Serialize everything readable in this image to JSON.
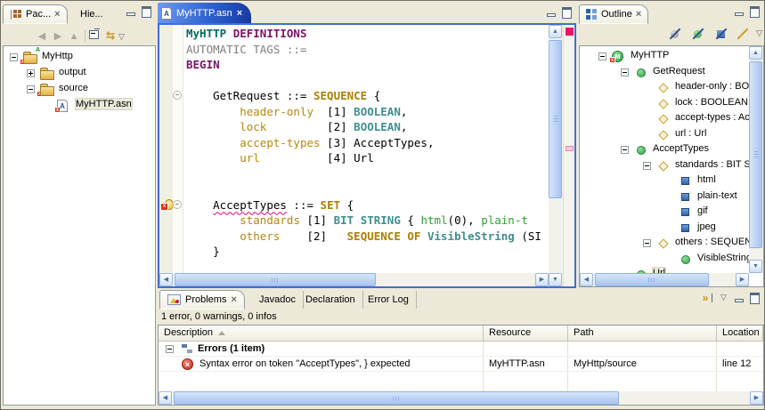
{
  "colors": {
    "active_editor_tab_blue": "#2E62D0",
    "focus_border_blue": "#3E6FD8",
    "error_marker_pink": "#ED1567",
    "selection_background": "#EBE9DA",
    "keyword_gold": "#AD7F00",
    "builtin_teal": "#3E8F8F",
    "definition_purple": "#7B1266"
  },
  "package_explorer": {
    "tabs": [
      {
        "label": "Pac..."
      },
      {
        "label": "Hie..."
      }
    ],
    "toolbar": {
      "icons": [
        "back",
        "forward",
        "up",
        "collapse-all",
        "link-with-editor",
        "view-menu"
      ]
    },
    "tree": [
      {
        "label": "MyHttp",
        "icon": "project",
        "error": true,
        "dec": "A",
        "expand": "minus",
        "level": 0
      },
      {
        "label": "output",
        "icon": "folder",
        "expand": "plus",
        "level": 1
      },
      {
        "label": "source",
        "icon": "folder",
        "error": true,
        "expand": "minus",
        "level": 1
      },
      {
        "label": "MyHTTP.asn",
        "icon": "asnfile",
        "error": true,
        "level": 2,
        "selected": true
      }
    ]
  },
  "editor": {
    "tab": {
      "label": "MyHTTP.asn"
    },
    "lines": [
      {
        "segments": [
          [
            "mod",
            "MyHTTP"
          ],
          [
            "plain",
            " "
          ],
          [
            "def",
            "DEFINITIONS"
          ]
        ]
      },
      {
        "segments": [
          [
            "gray",
            "AUTOMATIC TAGS ::="
          ]
        ]
      },
      {
        "segments": [
          [
            "def",
            "BEGIN"
          ]
        ]
      },
      {
        "segments": []
      },
      {
        "fold": "minus",
        "segments": [
          [
            "plain",
            "    GetRequest ::= "
          ],
          [
            "kw",
            "SEQUENCE"
          ],
          [
            "plain",
            " {"
          ]
        ]
      },
      {
        "segments": [
          [
            "plain",
            "        "
          ],
          [
            "fld",
            "header-only"
          ],
          [
            "plain",
            "  [1] "
          ],
          [
            "bi",
            "BOOLEAN"
          ],
          [
            "plain",
            ","
          ]
        ]
      },
      {
        "segments": [
          [
            "plain",
            "        "
          ],
          [
            "fld",
            "lock"
          ],
          [
            "plain",
            "         [2] "
          ],
          [
            "bi",
            "BOOLEAN"
          ],
          [
            "plain",
            ","
          ]
        ]
      },
      {
        "segments": [
          [
            "plain",
            "        "
          ],
          [
            "fld",
            "accept-types"
          ],
          [
            "plain",
            " [3] AcceptTypes,"
          ]
        ]
      },
      {
        "segments": [
          [
            "plain",
            "        "
          ],
          [
            "fld",
            "url"
          ],
          [
            "plain",
            "          [4] Url"
          ]
        ]
      },
      {
        "segments": []
      },
      {
        "segments": []
      },
      {
        "fold": "minus",
        "marker": "error",
        "segments": [
          [
            "plain",
            "    "
          ],
          [
            "err",
            "AcceptTypes"
          ],
          [
            "plain",
            " ::= "
          ],
          [
            "kw",
            "SET"
          ],
          [
            "plain",
            " {"
          ]
        ]
      },
      {
        "segments": [
          [
            "plain",
            "        "
          ],
          [
            "fld",
            "standards"
          ],
          [
            "plain",
            " [1] "
          ],
          [
            "bi",
            "BIT STRING"
          ],
          [
            "plain",
            " { "
          ],
          [
            "enum",
            "html"
          ],
          [
            "plain",
            "(0), "
          ],
          [
            "enum",
            "plain-t"
          ]
        ]
      },
      {
        "segments": [
          [
            "plain",
            "        "
          ],
          [
            "fld",
            "others"
          ],
          [
            "plain",
            "    [2]   "
          ],
          [
            "kw",
            "SEQUENCE OF"
          ],
          [
            "plain",
            " "
          ],
          [
            "bi",
            "VisibleString"
          ],
          [
            "plain",
            " (SI"
          ]
        ]
      },
      {
        "segments": [
          [
            "plain",
            "    }"
          ]
        ]
      }
    ]
  },
  "outline": {
    "tab": {
      "label": "Outline"
    },
    "toolbar": {
      "icons": [
        "sort",
        "hide-types",
        "hide-values",
        "hide-fields",
        "view-menu"
      ]
    },
    "tree": [
      {
        "label": "MyHTTP",
        "icon": "module",
        "error": true,
        "expand": "minus",
        "level": 0
      },
      {
        "label": "GetRequest",
        "icon": "type",
        "expand": "minus",
        "level": 1
      },
      {
        "label": "header-only : BOOLEAN",
        "icon": "field",
        "level": 2
      },
      {
        "label": "lock : BOOLEAN",
        "icon": "field",
        "level": 2
      },
      {
        "label": "accept-types : AcceptTypes",
        "icon": "field",
        "level": 2
      },
      {
        "label": "url : Url",
        "icon": "field",
        "level": 2
      },
      {
        "label": "AcceptTypes",
        "icon": "type",
        "expand": "minus",
        "level": 1
      },
      {
        "label": "standards : BIT STRING",
        "icon": "field",
        "expand": "minus",
        "level": 2
      },
      {
        "label": "html",
        "icon": "value",
        "level": 3
      },
      {
        "label": "plain-text",
        "icon": "value",
        "level": 3
      },
      {
        "label": "gif",
        "icon": "value",
        "level": 3
      },
      {
        "label": "jpeg",
        "icon": "value",
        "level": 3
      },
      {
        "label": "others : SEQUENCE OF",
        "icon": "field",
        "expand": "minus",
        "level": 2
      },
      {
        "label": "VisibleString",
        "icon": "type",
        "level": 3
      },
      {
        "label": "Url",
        "icon": "type",
        "level": 1,
        "selected": true
      }
    ]
  },
  "problems": {
    "tabs": [
      {
        "label": "Problems"
      },
      {
        "label": "Javadoc"
      },
      {
        "label": "Declaration"
      },
      {
        "label": "Error Log"
      }
    ],
    "summary": "1 error, 0 warnings, 0 infos",
    "columns": [
      "Description",
      "Resource",
      "Path",
      "Location"
    ],
    "groups": [
      {
        "label": "Errors (1 item)"
      }
    ],
    "rows": [
      {
        "description": "Syntax error on token \"AcceptTypes\", } expected",
        "resource": "MyHTTP.asn",
        "path": "MyHttp/source",
        "location": "line 12"
      }
    ]
  }
}
